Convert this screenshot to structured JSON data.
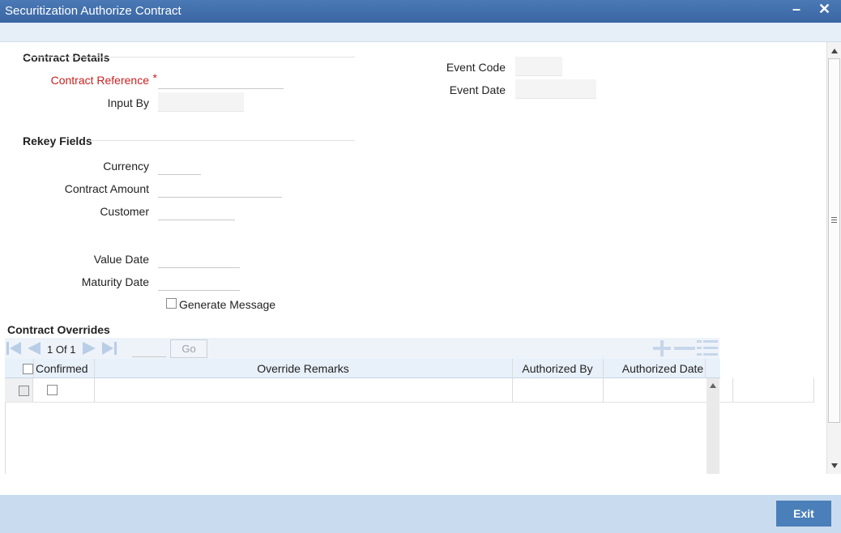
{
  "window": {
    "title": "Securitization Authorize Contract",
    "minimize": "–",
    "close": "✕"
  },
  "contract_details": {
    "heading": "Contract Details",
    "contract_reference": {
      "label": "Contract Reference",
      "required_mark": "*",
      "value": ""
    },
    "input_by": {
      "label": "Input By",
      "value": ""
    },
    "event_code": {
      "label": "Event Code",
      "value": ""
    },
    "event_date": {
      "label": "Event Date",
      "value": ""
    }
  },
  "rekey_fields": {
    "heading": "Rekey Fields",
    "currency": {
      "label": "Currency",
      "value": ""
    },
    "contract_amount": {
      "label": "Contract Amount",
      "value": ""
    },
    "customer": {
      "label": "Customer",
      "value": ""
    },
    "value_date": {
      "label": "Value Date",
      "value": ""
    },
    "maturity_date": {
      "label": "Maturity Date",
      "value": ""
    },
    "generate_message": {
      "label": "Generate Message",
      "checked": false
    }
  },
  "overrides": {
    "heading": "Contract Overrides",
    "pager": {
      "current": "1",
      "of_label": "Of",
      "total": "1",
      "go_label": "Go",
      "page_value": ""
    },
    "columns": [
      "Confirmed",
      "Override Remarks",
      "Authorized By",
      "Authorized Date"
    ],
    "rows": [
      {
        "confirmed": false,
        "remarks": "",
        "authorized_by": "",
        "authorized_date": ""
      }
    ]
  },
  "footer": {
    "exit_label": "Exit"
  },
  "colors": {
    "title_bar": "#3a66a3",
    "footer": "#c9dbee",
    "required": "#cc1f1f",
    "button": "#4a7fb9"
  }
}
